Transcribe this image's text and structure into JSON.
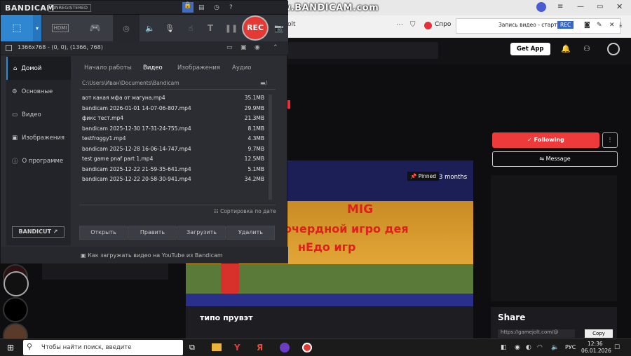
{
  "watermark": "www.BANDICAM.com",
  "browser": {
    "tab_text": "olt",
    "tab_partial": "Спро",
    "ext_status": "Запись видео - старт",
    "ext_rec": "REC"
  },
  "site": {
    "get_app": "Get App",
    "following": "Following",
    "message": "Message",
    "pinned": "Pinned",
    "age": "3 months",
    "game_title": "MIG",
    "game_line1": "очердной игро дея",
    "game_line2": "нЕдо игр",
    "post_title": "типо прувэт",
    "share": "Share",
    "share_url": "https://gamejolt.com/@",
    "copy": "Copy"
  },
  "bandicam": {
    "logo": "BANDICAM",
    "unregistered": "UNREGISTERED",
    "rec": "REC",
    "hdmi": "HDMI",
    "resolution": "1366x768 - (0, 0), (1366, 768)",
    "sidebar": [
      {
        "label": "Домой",
        "icon": "home-icon"
      },
      {
        "label": "Основные",
        "icon": "gear-icon"
      },
      {
        "label": "Видео",
        "icon": "video-icon"
      },
      {
        "label": "Изображения",
        "icon": "image-icon"
      },
      {
        "label": "О программе",
        "icon": "info-icon"
      }
    ],
    "bandicut": "BANDICUT",
    "tabs": [
      "Начало работы",
      "Видео",
      "Изображения",
      "Аудио"
    ],
    "path": "C:\\Users\\Иван\\Documents\\Bandicam",
    "files": [
      {
        "name": "вот какая мфа от магуна.mp4",
        "size": "35.1MB"
      },
      {
        "name": "bandicam 2026-01-01 14-07-06-807.mp4",
        "size": "29.9MB"
      },
      {
        "name": "фикс тест.mp4",
        "size": "21.3MB"
      },
      {
        "name": "bandicam 2025-12-30 17-31-24-755.mp4",
        "size": "8.1MB"
      },
      {
        "name": "testfroggy1.mp4",
        "size": "4.3MB"
      },
      {
        "name": "bandicam 2025-12-28 16-06-14-747.mp4",
        "size": "9.7MB"
      },
      {
        "name": "test game pnaf part 1.mp4",
        "size": "12.5MB"
      },
      {
        "name": "bandicam 2025-12-22 21-59-35-641.mp4",
        "size": "5.1MB"
      },
      {
        "name": "bandicam 2025-12-22 20-58-30-941.mp4",
        "size": "34.2MB"
      }
    ],
    "sort": "Сортировка по дате",
    "buttons": [
      "Открыть",
      "Править",
      "Загрузить",
      "Удалить"
    ],
    "footer": "Как загружать видео на YouTube из Bandicam"
  },
  "taskbar": {
    "search": "Чтобы найти поиск, введите",
    "lang": "РУС",
    "time": "12:36",
    "date": "06.01.2026"
  }
}
